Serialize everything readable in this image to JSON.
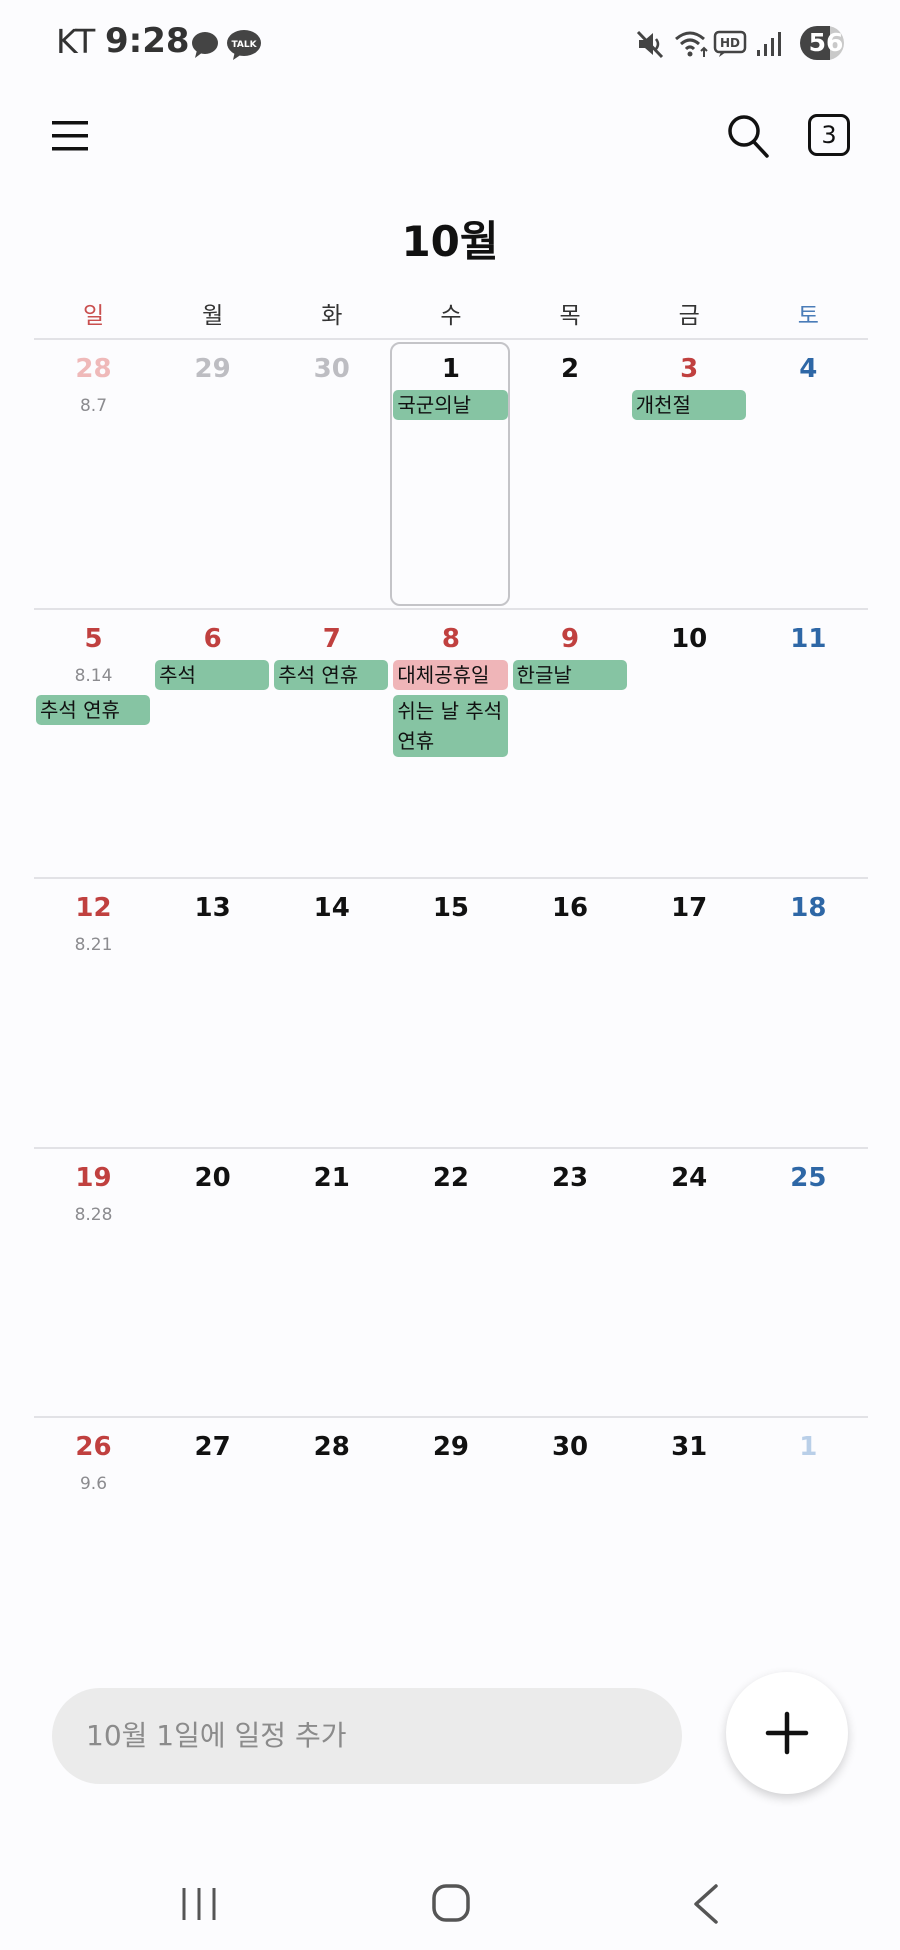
{
  "status_bar": {
    "carrier": "KT",
    "time": "9:28",
    "battery": "56",
    "hd_label": "HD",
    "talk_label": "TALK"
  },
  "header": {
    "today_badge": "3",
    "month_title": "10월"
  },
  "weekdays": [
    "일",
    "월",
    "화",
    "수",
    "목",
    "금",
    "토"
  ],
  "weeks": [
    {
      "days": [
        {
          "num": "28",
          "lunar": "8.7",
          "other": true
        },
        {
          "num": "29",
          "other": true
        },
        {
          "num": "30",
          "other": true
        },
        {
          "num": "1",
          "today": true
        },
        {
          "num": "2"
        },
        {
          "num": "3",
          "holiday": true
        },
        {
          "num": "4"
        }
      ],
      "events": [
        {
          "label": "국군의날",
          "col": 3
        },
        {
          "label": "개천절",
          "col": 5
        }
      ]
    },
    {
      "days": [
        {
          "num": "5",
          "lunar": "8.14"
        },
        {
          "num": "6",
          "holiday": true
        },
        {
          "num": "7",
          "holiday": true
        },
        {
          "num": "8",
          "holiday": true
        },
        {
          "num": "9",
          "holiday": true
        },
        {
          "num": "10"
        },
        {
          "num": "11"
        }
      ],
      "events": [
        {
          "label": "추석",
          "col": 1
        },
        {
          "label": "추석 연휴",
          "col": 2
        },
        {
          "label": "대체공휴일",
          "col": 3,
          "pink": true
        },
        {
          "label": "한글날",
          "col": 4
        },
        {
          "label": "추석 연휴",
          "col": 0,
          "row": 1
        },
        {
          "label": "쉬는 날 추석 연휴",
          "col": 3,
          "row": 1,
          "tall": true
        }
      ]
    },
    {
      "days": [
        {
          "num": "12",
          "lunar": "8.21"
        },
        {
          "num": "13"
        },
        {
          "num": "14"
        },
        {
          "num": "15"
        },
        {
          "num": "16"
        },
        {
          "num": "17"
        },
        {
          "num": "18"
        }
      ],
      "events": []
    },
    {
      "days": [
        {
          "num": "19",
          "lunar": "8.28"
        },
        {
          "num": "20"
        },
        {
          "num": "21"
        },
        {
          "num": "22"
        },
        {
          "num": "23"
        },
        {
          "num": "24"
        },
        {
          "num": "25"
        }
      ],
      "events": []
    },
    {
      "days": [
        {
          "num": "26",
          "lunar": "9.6"
        },
        {
          "num": "27"
        },
        {
          "num": "28"
        },
        {
          "num": "29"
        },
        {
          "num": "30"
        },
        {
          "num": "31"
        },
        {
          "num": "1",
          "other": true
        }
      ],
      "events": []
    }
  ],
  "quick_add": {
    "placeholder": "10월 1일에 일정 추가"
  },
  "colors": {
    "sunday": "#c0403f",
    "saturday": "#2e67a6",
    "event_green": "#86c4a3",
    "event_pink": "#efb5b8"
  },
  "icons": {
    "menu": "hamburger-menu-icon",
    "search": "search-icon",
    "add": "plus-icon",
    "recents": "recents-icon",
    "home": "home-icon",
    "back": "back-icon"
  }
}
